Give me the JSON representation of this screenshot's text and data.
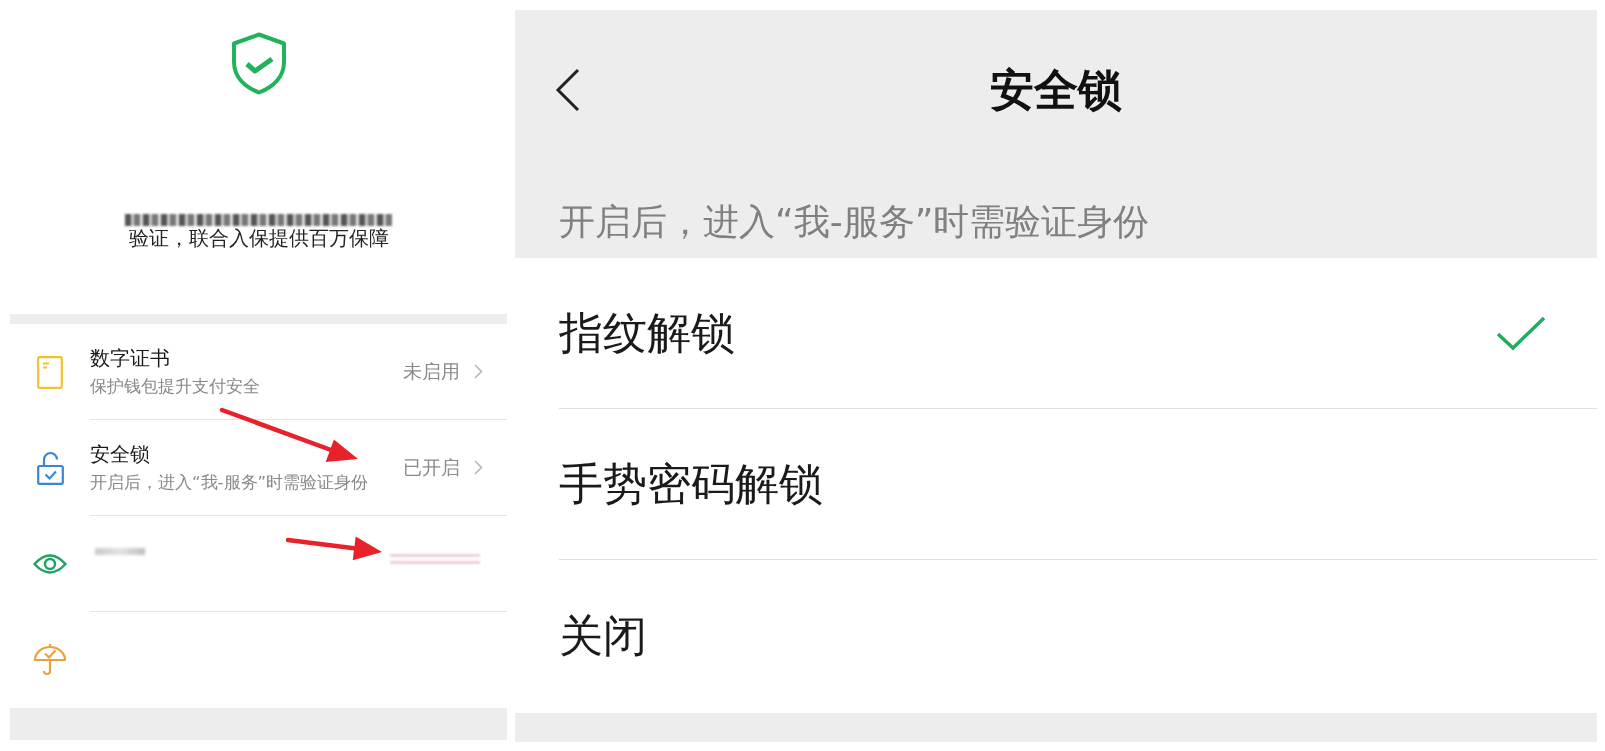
{
  "security_center": {
    "banner": {
      "text": "验证，联合入保提供百万保障",
      "blurred": true
    },
    "items": [
      {
        "kind": "certificate",
        "title": "数字证书",
        "subtitle": "保护钱包提升支付安全",
        "value": "未启用",
        "blurred": false
      },
      {
        "kind": "lock",
        "title": "安全锁",
        "subtitle": "开启后，进入“我-服务”时需验证身份",
        "value": "已开启",
        "blurred": false
      },
      {
        "kind": "eye",
        "blurred": true
      },
      {
        "kind": "umbrella",
        "blurred": false
      }
    ]
  },
  "security_lock": {
    "title": "安全锁",
    "hint": "开启后，进入“我-服务”时需验证身份",
    "options": [
      {
        "label": "指纹解锁",
        "selected": true
      },
      {
        "label": "手势密码解锁",
        "selected": false
      },
      {
        "label": "关闭",
        "selected": false
      }
    ]
  }
}
